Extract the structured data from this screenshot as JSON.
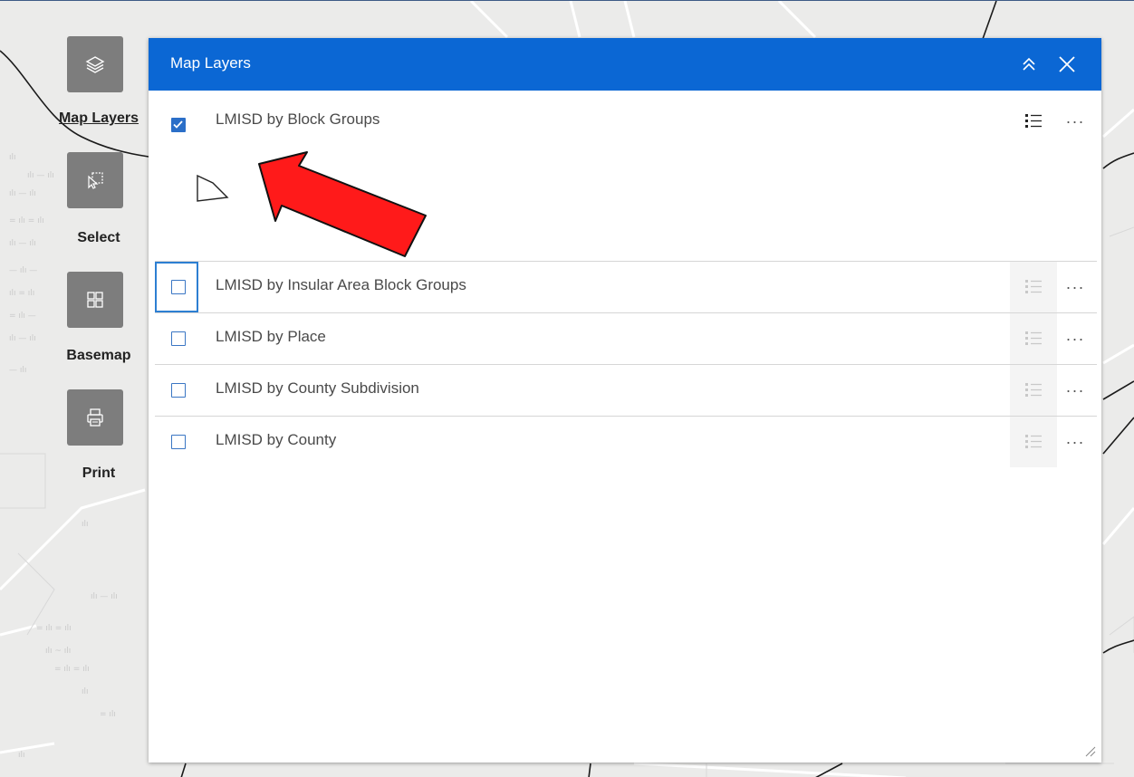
{
  "toolbar": {
    "items": [
      {
        "label": "Map Layers",
        "icon": "layers-icon",
        "active": true
      },
      {
        "label": "Select",
        "icon": "select-icon",
        "active": false
      },
      {
        "label": "Basemap",
        "icon": "basemap-gallery-icon",
        "active": false
      },
      {
        "label": "Print",
        "icon": "printer-icon",
        "active": false
      }
    ]
  },
  "panel": {
    "title": "Map Layers",
    "layers": [
      {
        "name": "LMISD by Block Groups",
        "checked": true
      },
      {
        "name": "LMISD by Insular Area Block Groups",
        "checked": false
      },
      {
        "name": "LMISD by Place",
        "checked": false
      },
      {
        "name": "LMISD by County Subdivision",
        "checked": false
      },
      {
        "name": "LMISD by County",
        "checked": false
      }
    ],
    "more_label": "···"
  },
  "colors": {
    "header": "#0b67d4",
    "toolbar_button": "#7d7d7d",
    "checkbox": "#2b6fc8",
    "annotation_arrow": "#ff1a1a"
  }
}
